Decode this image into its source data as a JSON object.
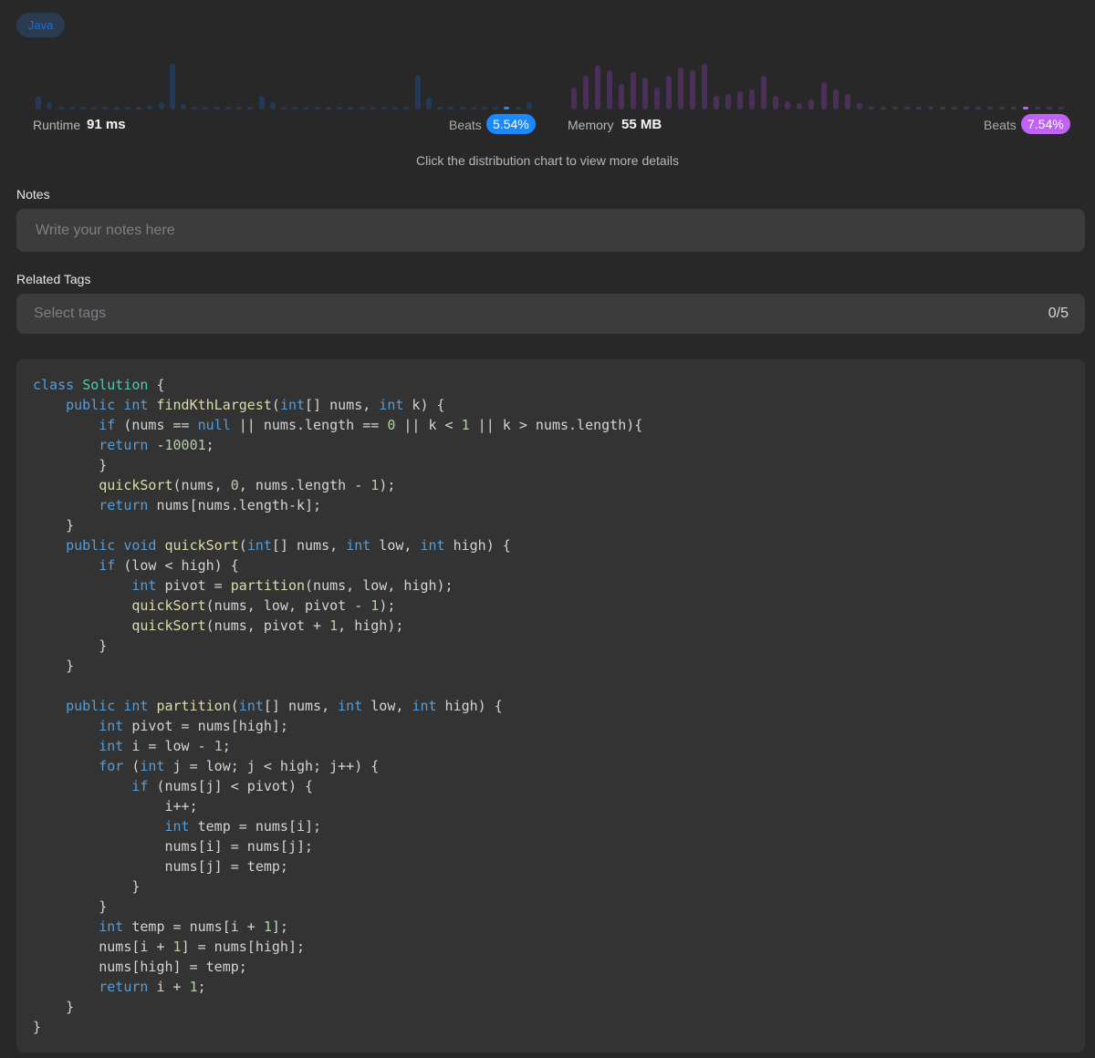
{
  "language": "Java",
  "runtime": {
    "label": "Runtime",
    "value": "91 ms",
    "beats_label": "Beats",
    "beats_value": "5.54%",
    "accent": "#1a89ff",
    "bar_color": "#223a57",
    "histogram": [
      14,
      8,
      2,
      2,
      2,
      2,
      2,
      2,
      2,
      2,
      4,
      8,
      48,
      6,
      2,
      2,
      2,
      2,
      2,
      2,
      14,
      8,
      2,
      2,
      2,
      2,
      2,
      2,
      2,
      2,
      2,
      2,
      2,
      2,
      36,
      12,
      2,
      2,
      2,
      2,
      2,
      2,
      2,
      2,
      8
    ]
  },
  "memory": {
    "label": "Memory",
    "value": "55 MB",
    "beats_label": "Beats",
    "beats_value": "7.54%",
    "accent": "#c261f6",
    "bar_color": "#4a2f59",
    "histogram": [
      22,
      34,
      44,
      40,
      26,
      38,
      32,
      22,
      34,
      42,
      40,
      46,
      14,
      16,
      18,
      20,
      34,
      14,
      8,
      6,
      10,
      28,
      20,
      16,
      6,
      2,
      2,
      2,
      2,
      2,
      2,
      2,
      2,
      2,
      2,
      2,
      2,
      2,
      2,
      2,
      2,
      2
    ]
  },
  "hint": "Click the distribution chart to view more details",
  "notes": {
    "label": "Notes",
    "placeholder": "Write your notes here"
  },
  "tags": {
    "label": "Related Tags",
    "placeholder": "Select tags",
    "count": "0/5"
  },
  "code": {
    "colors": {
      "keyword": "#569cd6",
      "class": "#4ec9b0",
      "function": "#dcdcaa",
      "number": "#b5cea8",
      "text": "#d4d4d4"
    },
    "lines": [
      "class Solution {",
      "    public int findKthLargest(int[] nums, int k) {",
      "        if (nums == null || nums.length == 0 || k < 1 || k > nums.length){",
      "        return -10001;",
      "        }",
      "        quickSort(nums, 0, nums.length - 1);",
      "        return nums[nums.length-k];",
      "    }",
      "    public void quickSort(int[] nums, int low, int high) {",
      "        if (low < high) {",
      "            int pivot = partition(nums, low, high);",
      "            quickSort(nums, low, pivot - 1);",
      "            quickSort(nums, pivot + 1, high);",
      "        }",
      "    }",
      "",
      "    public int partition(int[] nums, int low, int high) {",
      "        int pivot = nums[high];",
      "        int i = low - 1;",
      "        for (int j = low; j < high; j++) {",
      "            if (nums[j] < pivot) {",
      "                i++;",
      "                int temp = nums[i];",
      "                nums[i] = nums[j];",
      "                nums[j] = temp;",
      "            }",
      "        }",
      "        int temp = nums[i + 1];",
      "        nums[i + 1] = nums[high];",
      "        nums[high] = temp;",
      "        return i + 1;",
      "    }",
      "}"
    ]
  }
}
